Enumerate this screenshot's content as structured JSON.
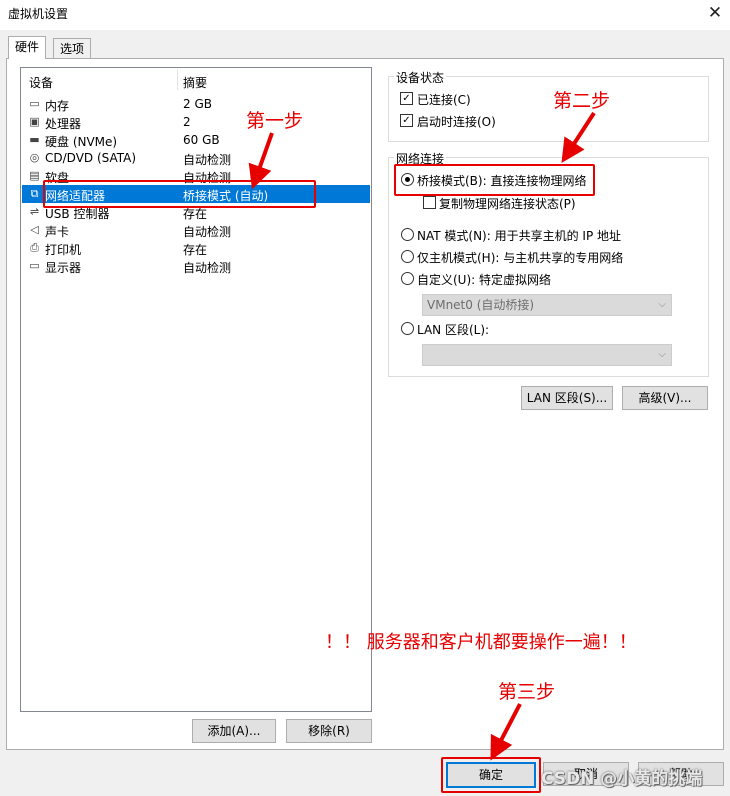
{
  "window": {
    "title": "虚拟机设置",
    "close_glyph": "✕"
  },
  "tabs": [
    {
      "label": "硬件"
    },
    {
      "label": "选项"
    }
  ],
  "device_list": {
    "headers": {
      "device": "设备",
      "summary": "摘要"
    },
    "rows": [
      {
        "icon": "memory-icon",
        "glyph": "▭",
        "device": "内存",
        "summary": "2 GB"
      },
      {
        "icon": "processor-icon",
        "glyph": "▣",
        "device": "处理器",
        "summary": "2"
      },
      {
        "icon": "disk-icon",
        "glyph": "▬",
        "device": "硬盘 (NVMe)",
        "summary": "60 GB"
      },
      {
        "icon": "cd-icon",
        "glyph": "◎",
        "device": "CD/DVD (SATA)",
        "summary": "自动检测"
      },
      {
        "icon": "floppy-icon",
        "glyph": "▤",
        "device": "软盘",
        "summary": "自动检测"
      },
      {
        "icon": "network-icon",
        "glyph": "⧉",
        "device": "网络适配器",
        "summary": "桥接模式 (自动)",
        "selected": true
      },
      {
        "icon": "usb-icon",
        "glyph": "⇌",
        "device": "USB 控制器",
        "summary": "存在"
      },
      {
        "icon": "sound-icon",
        "glyph": "◁",
        "device": "声卡",
        "summary": "自动检测"
      },
      {
        "icon": "printer-icon",
        "glyph": "⎙",
        "device": "打印机",
        "summary": "存在"
      },
      {
        "icon": "display-icon",
        "glyph": "▭",
        "device": "显示器",
        "summary": "自动检测"
      }
    ],
    "add_button": "添加(A)...",
    "remove_button": "移除(R)"
  },
  "device_status": {
    "label": "设备状态",
    "connected": {
      "label": "已连接(C)",
      "checked": true
    },
    "connect_at_power_on": {
      "label": "启动时连接(O)",
      "checked": true
    }
  },
  "network": {
    "label": "网络连接",
    "bridged": {
      "label": "桥接模式(B): 直接连接物理网络",
      "selected": true
    },
    "replicate": {
      "label": "复制物理网络连接状态(P)",
      "checked": false
    },
    "nat": {
      "label": "NAT 模式(N): 用于共享主机的 IP 地址"
    },
    "host_only": {
      "label": "仅主机模式(H): 与主机共享的专用网络"
    },
    "custom": {
      "label": "自定义(U): 特定虚拟网络",
      "combo_value": "VMnet0 (自动桥接)"
    },
    "lan_segment": {
      "label": "LAN 区段(L):",
      "combo_value": ""
    },
    "lan_segments_button": "LAN 区段(S)...",
    "advanced_button": "高级(V)..."
  },
  "footer": {
    "ok": "确定",
    "cancel": "取消",
    "help": "帮助"
  },
  "annotations": {
    "step1": "第一步",
    "step2": "第二步",
    "step3": "第三步",
    "note": "！！ 服务器和客户机都要操作一遍！！",
    "color": "#e60000"
  },
  "watermark": "CSDN @小黄的挑端"
}
